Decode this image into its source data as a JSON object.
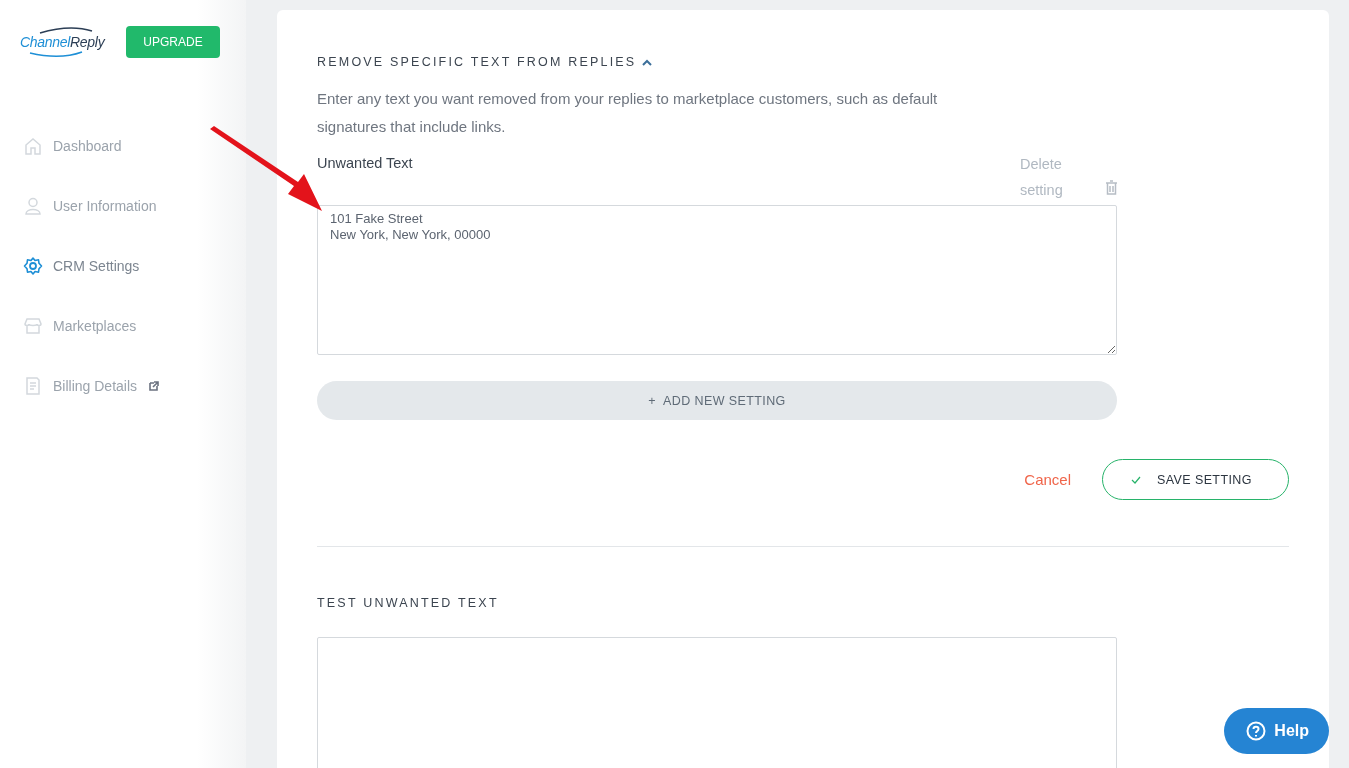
{
  "logo": {
    "words": [
      "Channel",
      "Reply"
    ]
  },
  "upgrade_button": "UPGRADE",
  "sidebar": {
    "items": [
      {
        "label": "Dashboard",
        "selected": false,
        "external": false
      },
      {
        "label": "User Information",
        "selected": false,
        "external": false
      },
      {
        "label": "CRM Settings",
        "selected": true,
        "external": false
      },
      {
        "label": "Marketplaces",
        "selected": false,
        "external": false
      },
      {
        "label": "Billing Details",
        "selected": false,
        "external": true
      }
    ]
  },
  "section": {
    "title": "REMOVE SPECIFIC TEXT FROM REPLIES",
    "expanded": true,
    "description": "Enter any text you want removed from your replies to marketplace customers, such as default signatures that include links.",
    "field_label": "Unwanted Text",
    "delete_label": "Delete setting",
    "value": "101 Fake Street\nNew York, New York, 00000",
    "add_button": "+  ADD NEW SETTING",
    "cancel": "Cancel",
    "save_button": "SAVE SETTING"
  },
  "test_section": {
    "title": "TEST UNWANTED TEXT"
  },
  "help_button": "Help"
}
